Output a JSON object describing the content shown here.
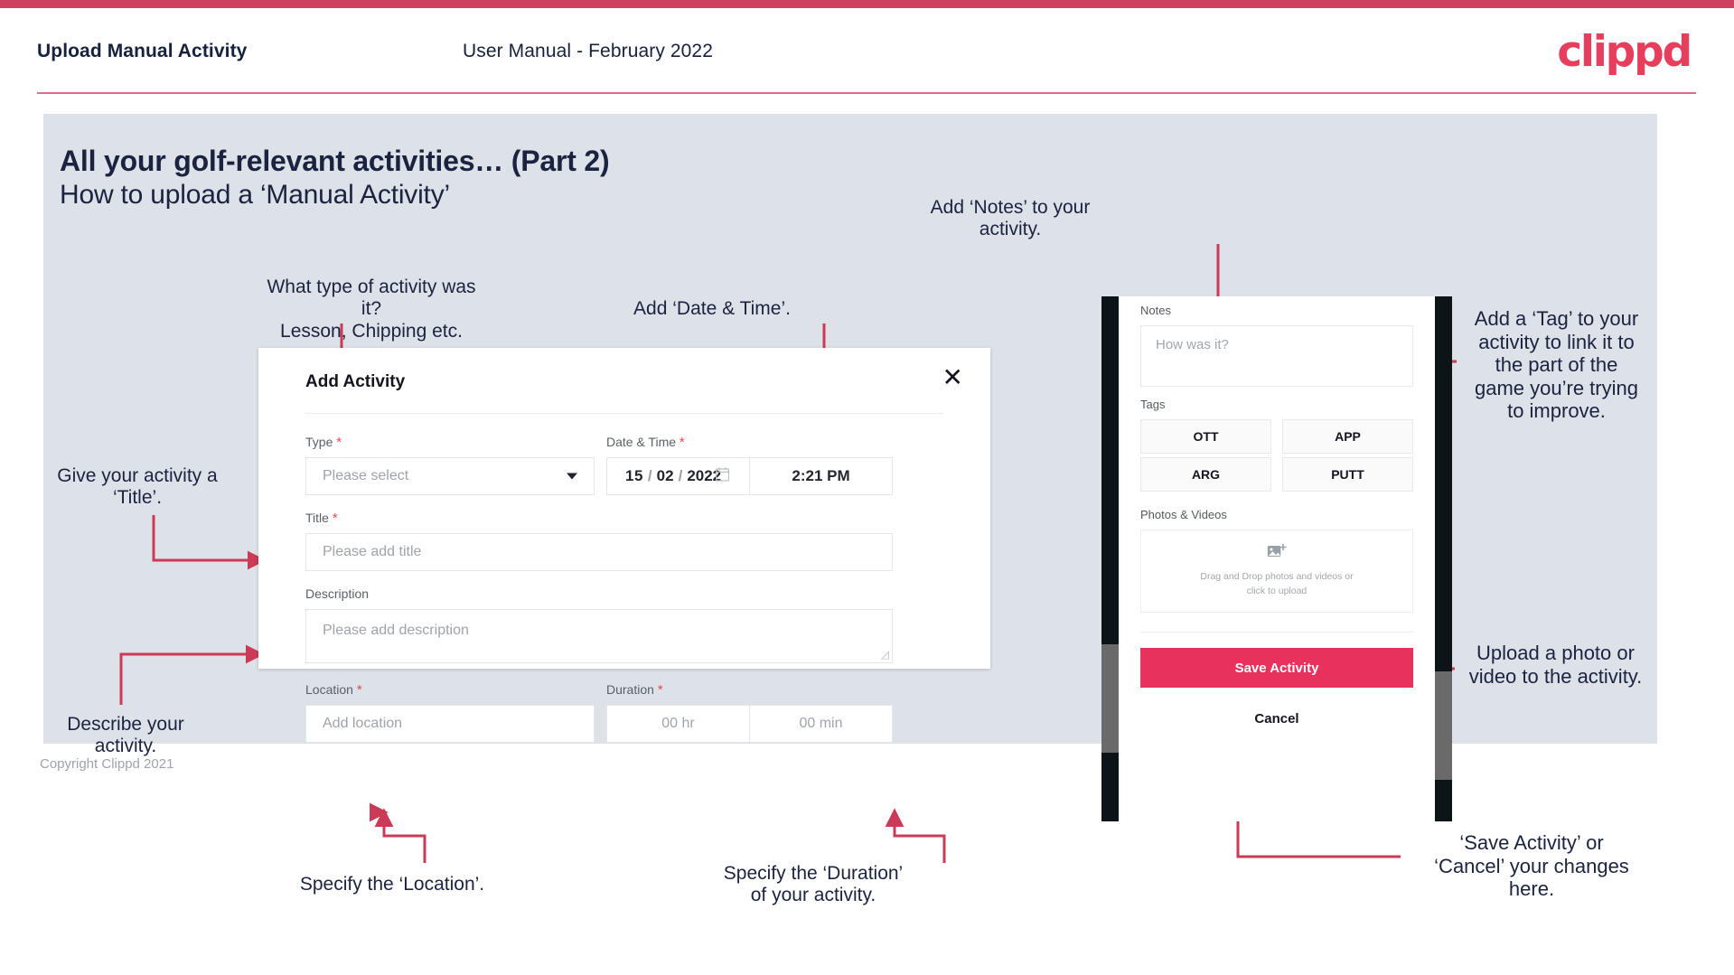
{
  "header": {
    "left_title": "Upload Manual Activity",
    "center_title": "User Manual - February 2022",
    "logo": "clippd",
    "brand_color": "#e63e5c",
    "rule_color": "#cf4160"
  },
  "slide": {
    "heading": "All your golf-relevant activities… (Part 2)",
    "subheading": "How to upload a ‘Manual Activity’",
    "background": "#dde2e9"
  },
  "annotations": {
    "type": "What type of activity was it?\nLesson, Chipping etc.",
    "datetime": "Add ‘Date & Time’.",
    "title": "Give your activity a\n‘Title’.",
    "description": "Describe your\nactivity.",
    "location": "Specify the ‘Location’.",
    "duration": "Specify the ‘Duration’\nof your activity.",
    "notes": "Add ‘Notes’ to your\nactivity.",
    "tags": "Add a ‘Tag’ to your\nactivity to link it to\nthe part of the\ngame you’re trying\nto improve.",
    "photos": "Upload a photo or\nvideo to the activity.",
    "save": "‘Save Activity’ or\n‘Cancel’ your changes\nhere."
  },
  "dialog": {
    "title": "Add Activity",
    "close_icon": "close-icon",
    "fields": {
      "type": {
        "label": "Type",
        "required": "*",
        "placeholder": "Please select",
        "icon": "chevron-down-icon"
      },
      "datetime": {
        "label": "Date & Time",
        "required": "*",
        "day": "15",
        "sep1": "/",
        "month": "02",
        "sep2": "/",
        "year": "2022",
        "time": "2:21 PM",
        "icon": "calendar-icon"
      },
      "title": {
        "label": "Title",
        "required": "*",
        "placeholder": "Please add title"
      },
      "description": {
        "label": "Description",
        "required": "",
        "placeholder": "Please add description"
      },
      "location": {
        "label": "Location",
        "required": "*",
        "placeholder": "Add location"
      },
      "duration": {
        "label": "Duration",
        "required": "*",
        "hours_placeholder": "00 hr",
        "minutes_placeholder": "00 min"
      }
    }
  },
  "phone": {
    "notes": {
      "label": "Notes",
      "placeholder": "How was it?"
    },
    "tags": {
      "label": "Tags",
      "items": [
        "OTT",
        "APP",
        "ARG",
        "PUTT"
      ]
    },
    "photos": {
      "label": "Photos & Videos",
      "icon": "add-image-icon",
      "drop_line1": "Drag and Drop photos and videos or",
      "drop_line2": "click to upload"
    },
    "save_label": "Save Activity",
    "cancel_label": "Cancel",
    "save_color": "#e8315c"
  },
  "footer": {
    "copyright": "Copyright Clippd 2021"
  }
}
